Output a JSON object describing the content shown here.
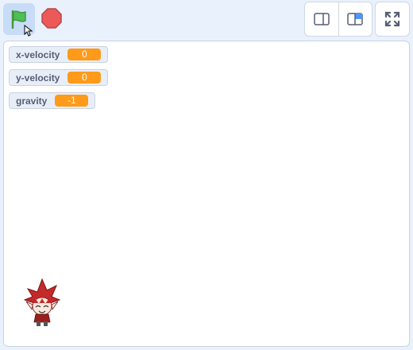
{
  "toolbar": {
    "green_flag_icon": "green-flag-icon",
    "stop_icon": "stop-sign-icon",
    "small_stage_icon": "small-stage-layout-icon",
    "large_stage_icon": "large-stage-layout-icon",
    "fullscreen_icon": "fullscreen-icon"
  },
  "monitors": [
    {
      "label": "x-velocity",
      "value": "0"
    },
    {
      "label": "y-velocity",
      "value": "0"
    },
    {
      "label": "gravity",
      "value": "-1"
    }
  ],
  "colors": {
    "monitor_value": "#ff9a1a",
    "flag_green": "#4cbf56",
    "stop_red": "#ec5959",
    "accent_blue": "#4c97ff"
  },
  "sprite": {
    "icon": "red-haired-character-sprite"
  }
}
